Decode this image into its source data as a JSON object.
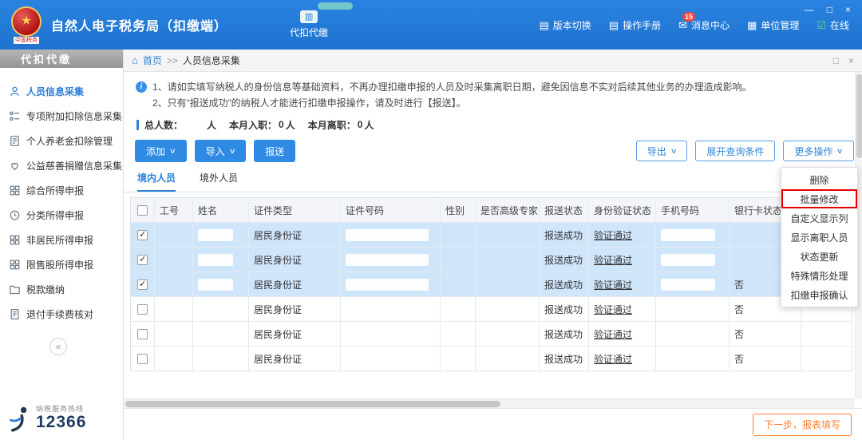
{
  "window": {
    "minimize": "—",
    "maximize": "□",
    "close": "×"
  },
  "topbar": {
    "emblem_caption": "中国税务",
    "app_title": "自然人电子税务局（扣缴端）",
    "module_tab": "代扣代缴",
    "nav": [
      {
        "label": "版本切换",
        "icon": "document-icon"
      },
      {
        "label": "操作手册",
        "icon": "manual-icon"
      },
      {
        "label": "消息中心",
        "icon": "mail-icon",
        "badge": "15"
      },
      {
        "label": "单位管理",
        "icon": "building-icon"
      },
      {
        "label": "在线",
        "icon": "online-status-icon"
      }
    ]
  },
  "sidebar": {
    "header": "代扣代缴",
    "items": [
      {
        "label": "人员信息采集",
        "icon": "person-icon",
        "active": true
      },
      {
        "label": "专项附加扣除信息采集",
        "icon": "deduction-list-icon"
      },
      {
        "label": "个人养老金扣除管理",
        "icon": "pension-doc-icon"
      },
      {
        "label": "公益慈善捐赠信息采集",
        "icon": "donation-heart-icon"
      },
      {
        "label": "综合所得申报",
        "icon": "grid-icon"
      },
      {
        "label": "分类所得申报",
        "icon": "clock-icon"
      },
      {
        "label": "非居民所得申报",
        "icon": "grid-icon"
      },
      {
        "label": "限售股所得申报",
        "icon": "grid-icon"
      },
      {
        "label": "税款缴纳",
        "icon": "folder-icon"
      },
      {
        "label": "退付手续费核对",
        "icon": "receipt-icon"
      }
    ],
    "collapse_glyph": "«",
    "hotline_label": "纳税服务热线",
    "hotline_number": "12366"
  },
  "breadcrumb": {
    "home": "首页",
    "separator": ">>",
    "current": "人员信息采集",
    "panel_restore": "□",
    "panel_close": "×"
  },
  "notice": {
    "line1": "1、请如实填写纳税人的身份信息等基础资料，不再办理扣缴申报的人员及时采集离职日期，避免因信息不实对后续其他业务的办理造成影响。",
    "line2": "2、只有“报送成功”的纳税人才能进行扣缴申报操作，请及时进行【报送】。"
  },
  "stats": {
    "total_label": "总人数：",
    "total_unit": "人",
    "join_label": "本月入职：",
    "join_value": "0",
    "join_unit": "人",
    "leave_label": "本月离职：",
    "leave_value": "0",
    "leave_unit": "人"
  },
  "toolbar": {
    "add": "添加",
    "import": "导入",
    "submit": "报送",
    "export": "导出",
    "expand_query": "展开查询条件",
    "more_actions": "更多操作",
    "caret": "∨"
  },
  "tabs": {
    "domestic": "境内人员",
    "foreign": "境外人员"
  },
  "table": {
    "headers": [
      "工号",
      "姓名",
      "证件类型",
      "证件号码",
      "性别",
      "是否高级专家",
      "报送状态",
      "身份验证状态",
      "手机号码",
      "银行卡状态"
    ],
    "rows": [
      {
        "checked": true,
        "id_type": "居民身份证",
        "submit_status": "报送成功",
        "verify_status": "验证通过",
        "bank_status": ""
      },
      {
        "checked": true,
        "id_type": "居民身份证",
        "submit_status": "报送成功",
        "verify_status": "验证通过",
        "bank_status": ""
      },
      {
        "checked": true,
        "id_type": "居民身份证",
        "submit_status": "报送成功",
        "verify_status": "验证通过",
        "bank_status": "否"
      },
      {
        "checked": false,
        "id_type": "居民身份证",
        "submit_status": "报送成功",
        "verify_status": "验证通过",
        "bank_status": "否"
      },
      {
        "checked": false,
        "id_type": "居民身份证",
        "submit_status": "报送成功",
        "verify_status": "验证通过",
        "bank_status": "否"
      },
      {
        "checked": false,
        "id_type": "居民身份证",
        "submit_status": "报送成功",
        "verify_status": "验证通过",
        "bank_status": "否"
      }
    ]
  },
  "more_menu": {
    "items": [
      "删除",
      "批量修改",
      "自定义显示列",
      "显示离职人员",
      "状态更新",
      "特殊情形处理",
      "扣缴申报确认"
    ],
    "highlighted": "批量修改"
  },
  "footer": {
    "next_step": "下一步，报表填写"
  }
}
